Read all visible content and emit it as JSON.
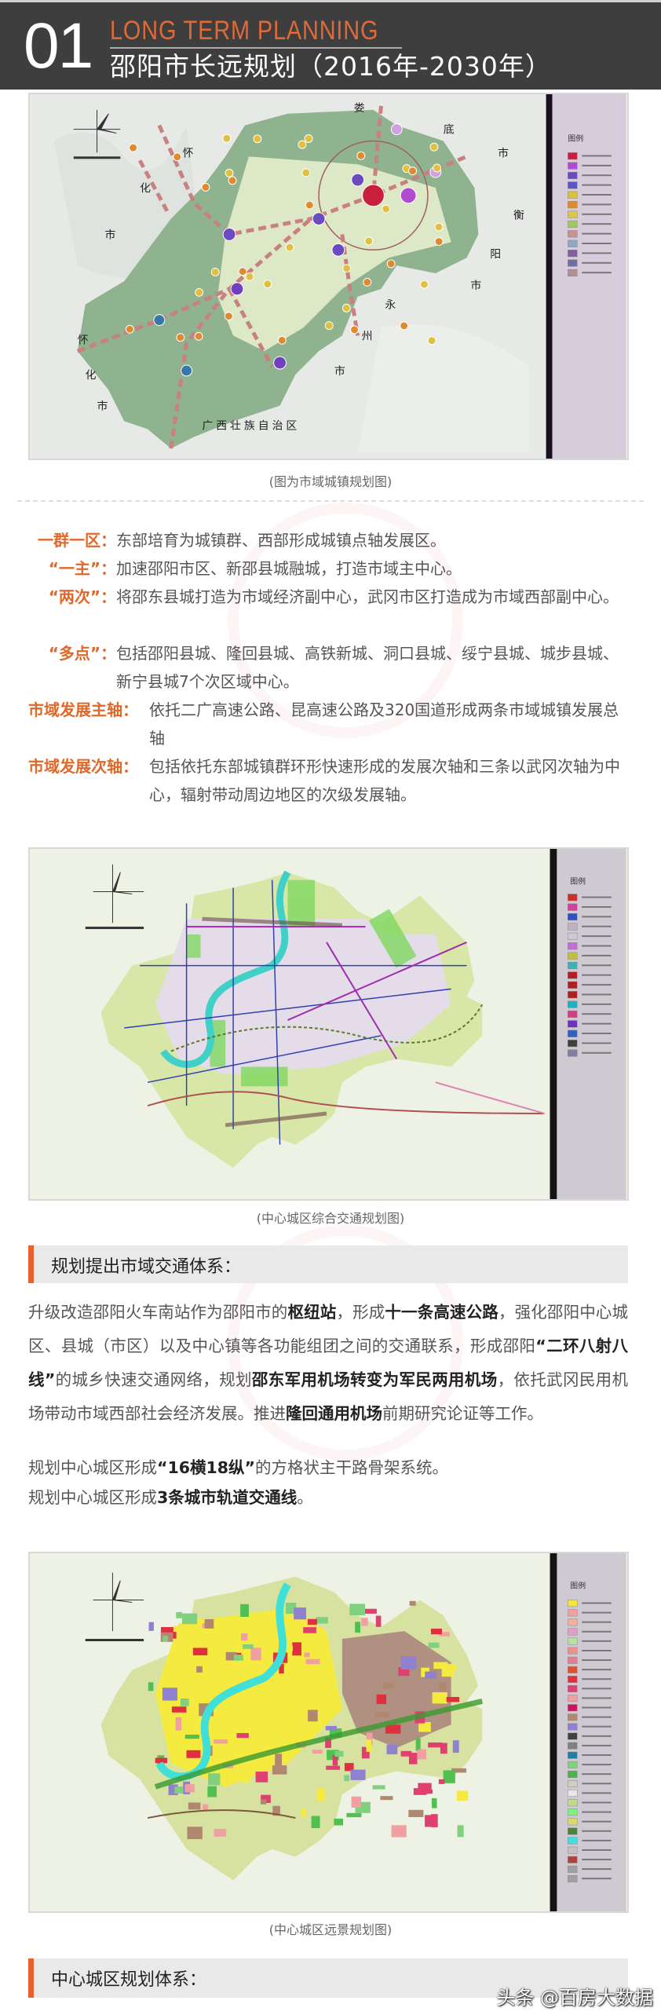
{
  "header": {
    "number": "01",
    "title_en": "LONG TERM PLANNING",
    "title_zh": "邵阳市长远规划（2016年-2030年）"
  },
  "map1": {
    "legend_title": "图例",
    "labels": [
      "娄",
      "底",
      "市",
      "衡",
      "阳",
      "市",
      "永",
      "州",
      "市",
      "怀",
      "化",
      "市",
      "怀",
      "化",
      "市",
      "广西壮族自治区"
    ],
    "legend_colors": [
      "#c8203c",
      "#b04ad0",
      "#6a4cc0",
      "#5a56c8",
      "#d8c040",
      "#e08a30",
      "#d8c850",
      "#a0c860",
      "#c89090",
      "#90a8c0",
      "#8060a0",
      "#7070a0",
      "#b09090"
    ]
  },
  "caption1": "(图为市域城镇规划图)",
  "points": [
    {
      "label": "一群一区：",
      "text": "东部培育为城镇群、西部形成城镇点轴发展区。"
    },
    {
      "label": "“一主”：",
      "text": "加速邵阳市区、新邵县城融城，打造市域主中心。"
    },
    {
      "label": "“两次”：",
      "text": "将邵东县城打造为市域经济副中心，武冈市区打造成为市域西部副中心。"
    },
    {
      "label": "“多点”：",
      "text": "包括邵阳县城、隆回县城、高铁新城、洞口县城、绥宁县城、城步县城、新宁县城7个次区域中心。"
    },
    {
      "label": "市域发展主轴：",
      "text": "依托二广高速公路、昆高速公路及320国道形成两条市域城镇发展总轴"
    },
    {
      "label": "市域发展次轴：",
      "text": "包括依托东部城镇群环形快速形成的发展次轴和三条以武冈次轴为中心，辐射带动周边地区的次级发展轴。"
    }
  ],
  "map2": {
    "legend_title": "图例",
    "legend_colors": [
      "#c83030",
      "#d040a0",
      "#3050c0",
      "#c0b0c0",
      "#d0c8d0",
      "#c070d0",
      "#c0c040",
      "#40b0b0",
      "#b02020",
      "#b02020",
      "#b02020",
      "#20b0c0",
      "#d04080",
      "#7030c0",
      "#3060c0",
      "#404040",
      "#8080a0"
    ]
  },
  "caption2": "(中心城区综合交通规划图)",
  "section1": "规划提出市域交通体系：",
  "transport": {
    "p1": [
      "升级改造邵阳火车南站作为邵阳市的",
      "枢纽站",
      "，形成",
      "十一条高速公路",
      "，强化邵阳中心城区、县城（市区）以及中心镇等各功能组团之间的交通联系，形成邵阳",
      "“二环八射八线”",
      "的城乡快速交通网络，规划",
      "邵东军用机场转变为军民两用机场",
      "，依托武冈民用机场带动市域西部社会经济发展。推进",
      "隆回通用机场",
      "前期研究论证等工作。"
    ],
    "p2": [
      "规划中心城区形成",
      "“16横18纵”",
      "的方格状主干路骨架系统。"
    ],
    "p3": [
      "规划中心城区形成",
      "3条城市轨道交通线",
      "。"
    ]
  },
  "map3": {
    "legend_title": "图例",
    "legend_colors": [
      "#f2e640",
      "#f0a0a0",
      "#f0b0a0",
      "#e0a0c8",
      "#b8e0a0",
      "#f09090",
      "#e08090",
      "#e05030",
      "#e03040",
      "#e04070",
      "#f0a0a0",
      "#d01060",
      "#b08870",
      "#9080d0",
      "#404040",
      "#808080",
      "#2080a0",
      "#80d080",
      "#50b050",
      "#d0d0c0",
      "#e8e8e8",
      "#c0d890",
      "#80f080",
      "#d8d870",
      "#508040",
      "#40e0e0",
      "#c0c0c0",
      "#b04040",
      "#a0a0a0",
      "#a0a0a0"
    ]
  },
  "caption3": "(中心城区远景规划图)",
  "section2": "中心城区规划体系：",
  "watermark": "头条 @百房大数据"
}
